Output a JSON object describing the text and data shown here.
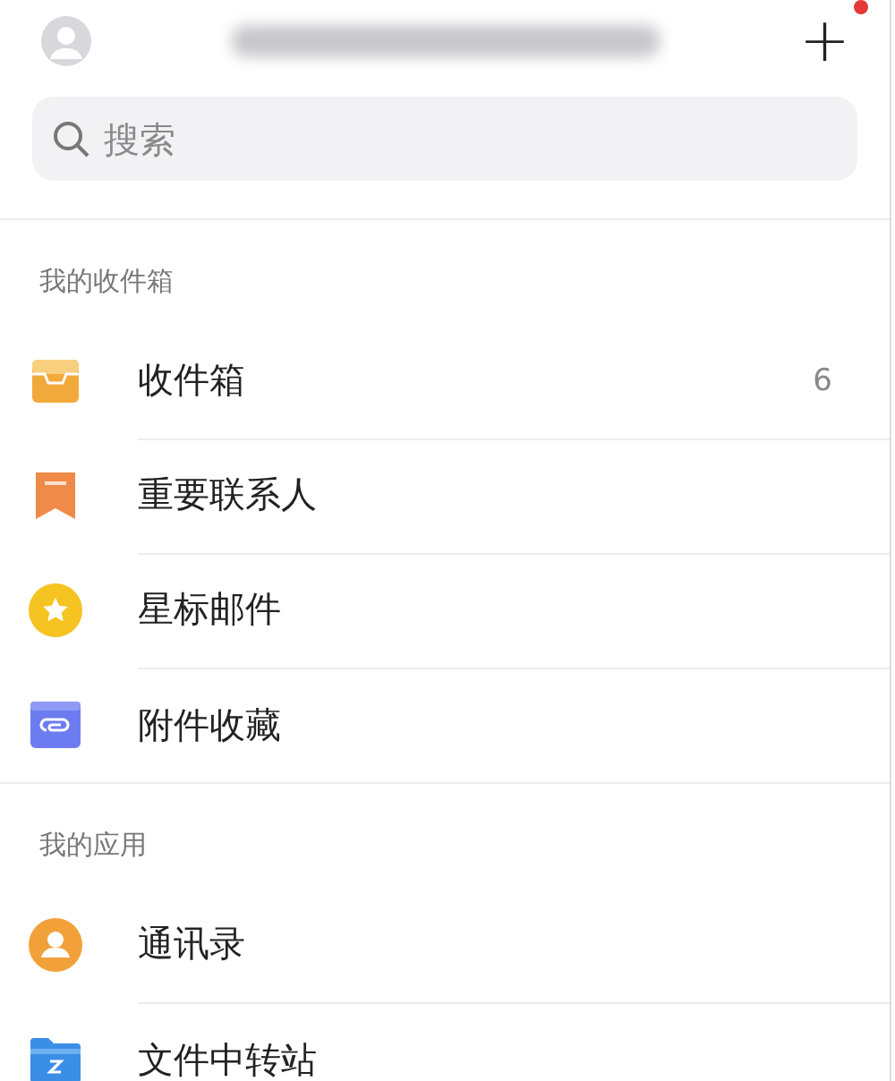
{
  "top_bar": {
    "add_button": {
      "label": "+",
      "notification_dot": true
    }
  },
  "search": {
    "placeholder": "搜索"
  },
  "sections": [
    {
      "title": "我的收件箱",
      "items": [
        {
          "kind": "inbox",
          "label": "收件箱",
          "count": "6"
        },
        {
          "kind": "bookmark",
          "label": "重要联系人"
        },
        {
          "kind": "star",
          "label": "星标邮件"
        },
        {
          "kind": "attachment",
          "label": "附件收藏"
        }
      ]
    },
    {
      "title": "我的应用",
      "items": [
        {
          "kind": "contacts",
          "label": "通讯录"
        },
        {
          "kind": "folder",
          "label": "文件中转站"
        }
      ]
    }
  ]
}
